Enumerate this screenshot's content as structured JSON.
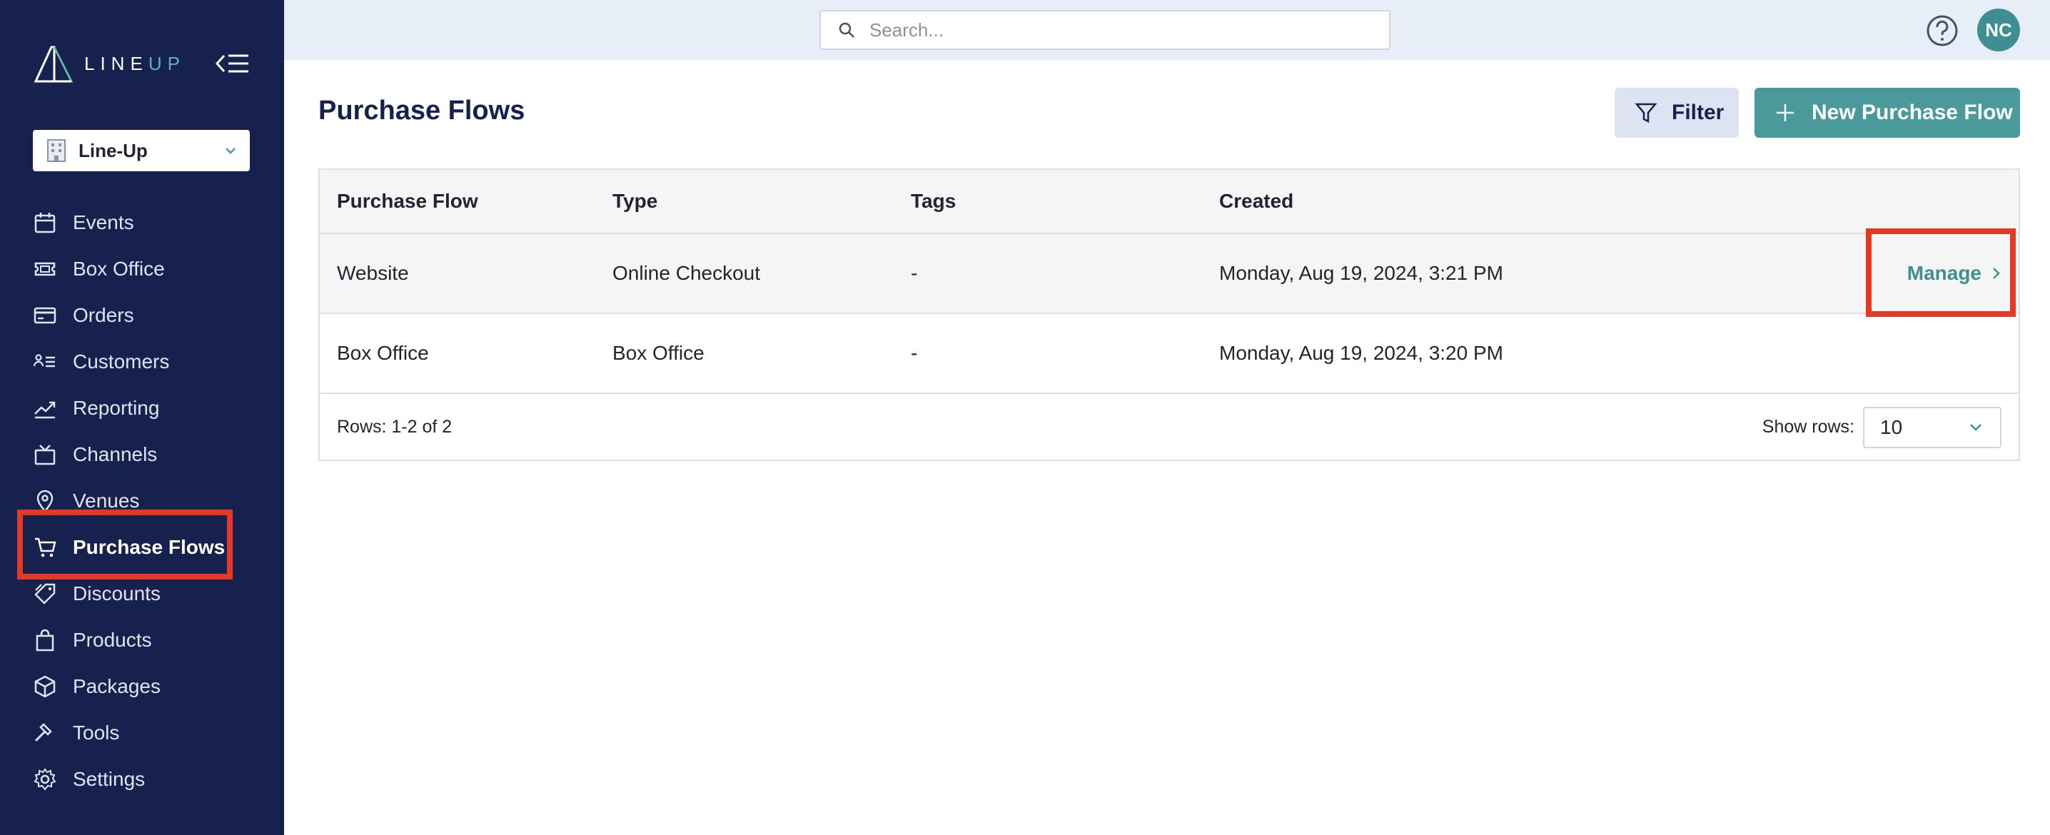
{
  "app": {
    "logo_text_main": "LINE",
    "logo_text_accent": "UP"
  },
  "org_selector": {
    "value": "Line-Up"
  },
  "sidebar": {
    "items": [
      {
        "label": "Events",
        "icon": "calendar-icon"
      },
      {
        "label": "Box Office",
        "icon": "ticket-icon"
      },
      {
        "label": "Orders",
        "icon": "credit-card-icon"
      },
      {
        "label": "Customers",
        "icon": "customers-list-icon"
      },
      {
        "label": "Reporting",
        "icon": "trending-chart-icon"
      },
      {
        "label": "Channels",
        "icon": "tv-icon"
      },
      {
        "label": "Venues",
        "icon": "map-pin-icon"
      },
      {
        "label": "Purchase Flows",
        "icon": "shopping-cart-icon",
        "active": true
      },
      {
        "label": "Discounts",
        "icon": "tag-icon"
      },
      {
        "label": "Products",
        "icon": "shopping-bag-icon"
      },
      {
        "label": "Packages",
        "icon": "package-box-icon"
      },
      {
        "label": "Tools",
        "icon": "hammer-icon"
      },
      {
        "label": "Settings",
        "icon": "gear-icon"
      }
    ]
  },
  "topbar": {
    "search_placeholder": "Search...",
    "user_initials": "NC"
  },
  "page": {
    "title": "Purchase Flows",
    "filter_label": "Filter",
    "new_label": "New Purchase Flow"
  },
  "table": {
    "columns": [
      "Purchase Flow",
      "Type",
      "Tags",
      "Created"
    ],
    "rows": [
      {
        "purchase_flow": "Website",
        "type": "Online Checkout",
        "tags": "-",
        "created": "Monday, Aug 19, 2024, 3:21 PM",
        "action": "Manage"
      },
      {
        "purchase_flow": "Box Office",
        "type": "Box Office",
        "tags": "-",
        "created": "Monday, Aug 19, 2024, 3:20 PM"
      }
    ],
    "rows_info": "Rows: 1-2 of 2",
    "show_rows_label": "Show rows:",
    "show_rows_value": "10"
  },
  "colors": {
    "sidebar_bg": "#17214e",
    "accent_teal": "#4b9a9b",
    "highlight_red": "#e33a28",
    "topbar_bg": "#e8eef7"
  }
}
